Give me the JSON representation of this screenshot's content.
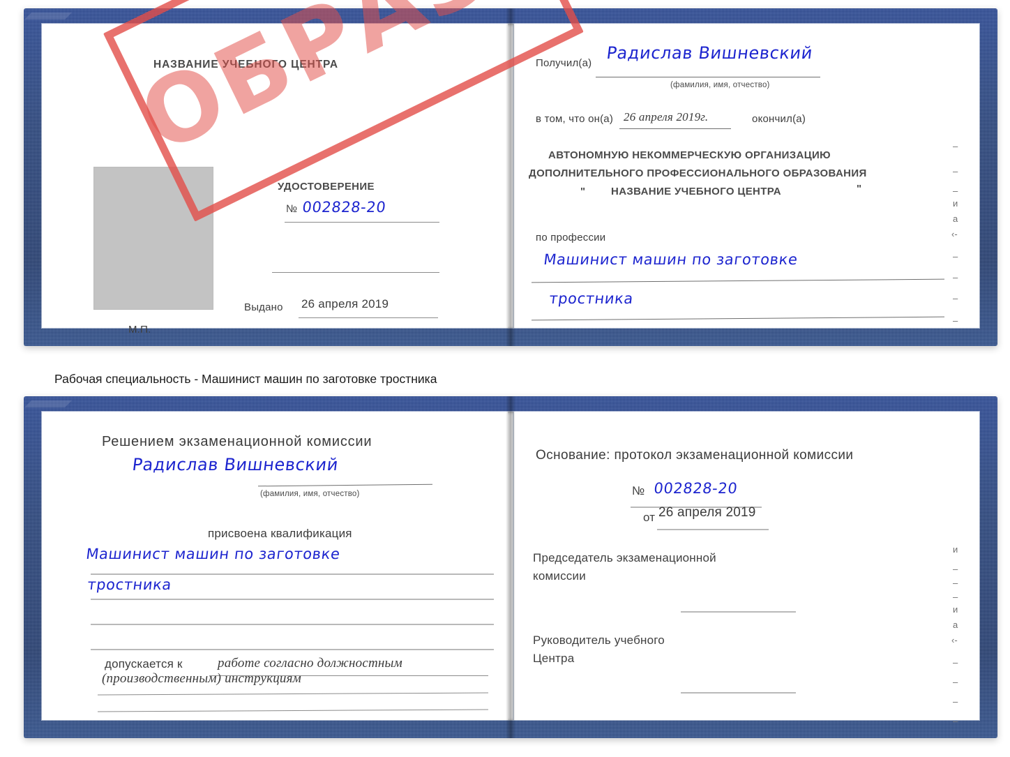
{
  "caption": "Рабочая специальность - Машинист машин по заготовке тростника",
  "watermark": {
    "text": "ОБРАЗЕЦ",
    "color": "#e24e48"
  },
  "colors": {
    "cover_blue": "#24427f",
    "ink_blue": "#1d25cf",
    "stamp_red": "#e24e48",
    "page_white": "#ffffff",
    "photo_gray": "#c3c3c3"
  },
  "certificate_front": {
    "left_page": {
      "center_name": "НАЗВАНИЕ УЧЕБНОГО ЦЕНТРА",
      "doc_type": "УДОСТОВЕРЕНИЕ",
      "number_label": "№",
      "number_value": "002828-20",
      "issued_label": "Выдано",
      "issued_value": "26 апреля 2019",
      "seal_label": "М.П."
    },
    "right_page": {
      "received_label": "Получил(а)",
      "received_value": "Радислав Вишневский",
      "fio_hint": "(фамилия, имя, отчество)",
      "that_he_label": "в том, что он(а)",
      "that_he_date": "26 апреля 2019г.",
      "finished_label": "окончил(а)",
      "org_line1": "АВТОНОМНУЮ НЕКОММЕРЧЕСКУЮ ОРГАНИЗАЦИЮ",
      "org_line2": "ДОПОЛНИТЕЛЬНОГО ПРОФЕССИОНАЛЬНОГО ОБРАЗОВАНИЯ",
      "org_quote_open": "\"",
      "org_line3": "НАЗВАНИЕ УЧЕБНОГО ЦЕНТРА",
      "org_quote_close": "\"",
      "profession_label": "по профессии",
      "profession_line1": "Машинист машин по заготовке",
      "profession_line2": "тростника",
      "margin_marks": [
        "–",
        "–",
        "–",
        "и",
        "а",
        "‹-",
        "–",
        "–",
        "–",
        "–"
      ]
    }
  },
  "certificate_back": {
    "left_page": {
      "decision_title": "Решением экзаменационной комиссии",
      "name_value": "Радислав Вишневский",
      "fio_hint": "(фамилия, имя, отчество)",
      "qualification_label": "присвоена квалификация",
      "qualification_line1": "Машинист машин по заготовке",
      "qualification_line2": "тростника",
      "admitted_label": "допускается к",
      "admitted_line1": "работе согласно должностным",
      "admitted_line2": "(производственным) инструкциям"
    },
    "right_page": {
      "basis_label": "Основание: протокол экзаменационной комиссии",
      "number_label": "№",
      "number_value": "002828-20",
      "date_label": "от",
      "date_value": "26 апреля 2019",
      "chairman_line1": "Председатель экзаменационной",
      "chairman_line2": "комиссии",
      "head_line1": "Руководитель учебного",
      "head_line2": "Центра",
      "margin_marks": [
        "и",
        "–",
        "–",
        "–",
        "и",
        "а",
        "‹-",
        "–",
        "–",
        "–",
        "–"
      ]
    }
  }
}
